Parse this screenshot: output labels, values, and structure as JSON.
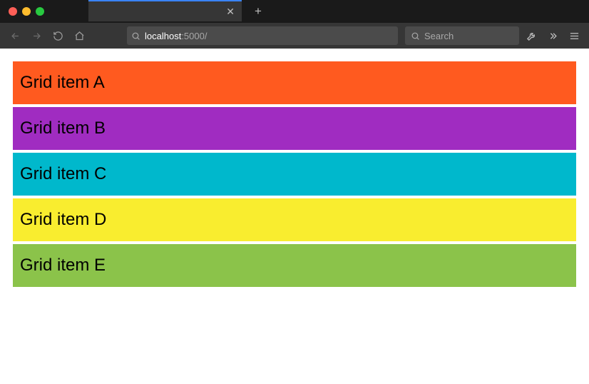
{
  "toolbar": {
    "url_host": "localhost",
    "url_rest": ":5000/",
    "search_placeholder": "Search"
  },
  "grid": {
    "items": [
      {
        "label": "Grid item A",
        "color": "#ff5a1f"
      },
      {
        "label": "Grid item B",
        "color": "#a02cc1"
      },
      {
        "label": "Grid item C",
        "color": "#00b8cc"
      },
      {
        "label": "Grid item D",
        "color": "#f9ed2f"
      },
      {
        "label": "Grid item E",
        "color": "#8bc34a"
      }
    ]
  }
}
